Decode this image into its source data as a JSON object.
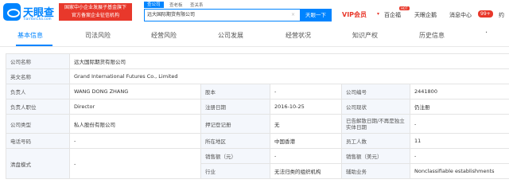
{
  "header": {
    "logo_text": "天眼查",
    "logo_sub": "TianYanCha.com",
    "banner_line1": "国家中小企业发展子基金旗下",
    "banner_line2": "官方备案企业征信机构",
    "search_tabs": [
      "查公司",
      "查老板",
      "查关系"
    ],
    "search_value": "远大国际期货有限公司",
    "clear_icon": "×",
    "search_button": "天眼一下",
    "nav": {
      "vip": "VIP会员",
      "baishanghui": "百企福",
      "hot": "HOT",
      "tianyan_app": "天眼企鹅",
      "messages": "消息中心",
      "messages_badge": "99+",
      "user": "约"
    }
  },
  "tabs": [
    "基本信息",
    "司法风险",
    "经营风险",
    "公司发展",
    "经营状况",
    "知识产权",
    "历史信息"
  ],
  "tabs_extra_icon": "·",
  "table": {
    "company_name_label": "公司名称",
    "company_name": "远大国际期货有限公司",
    "english_name_label": "英文名称",
    "english_name": "Grand International Futures Co., Limited",
    "rows": [
      [
        "负责人",
        "WANG DONG ZHANG",
        "股本",
        "-",
        "公司编号",
        "2441800"
      ],
      [
        "负责人职位",
        "Director",
        "注册日期",
        "2016-10-25",
        "公司现状",
        "仍注册"
      ],
      [
        "公司类型",
        "私人股份有限公司",
        "押记登记册",
        "无",
        "已告解散日期/不再是独立实体日期",
        "-"
      ],
      [
        "电话号码",
        "-",
        "所在地区",
        "中国香港",
        "员工人数",
        "11"
      ]
    ],
    "last_label": "清盘模式",
    "last_value": "-",
    "sub_rows": [
      [
        "销售额（元）",
        "-",
        "销售额（美元）",
        "-"
      ],
      [
        "行业",
        "无法归类的组织机构",
        "辅助业务",
        "Nonclassifiable establishments"
      ]
    ]
  },
  "colors": {
    "brand": "#0084ff",
    "red": "#e8382b",
    "label_bg": "#f4f7fc"
  }
}
